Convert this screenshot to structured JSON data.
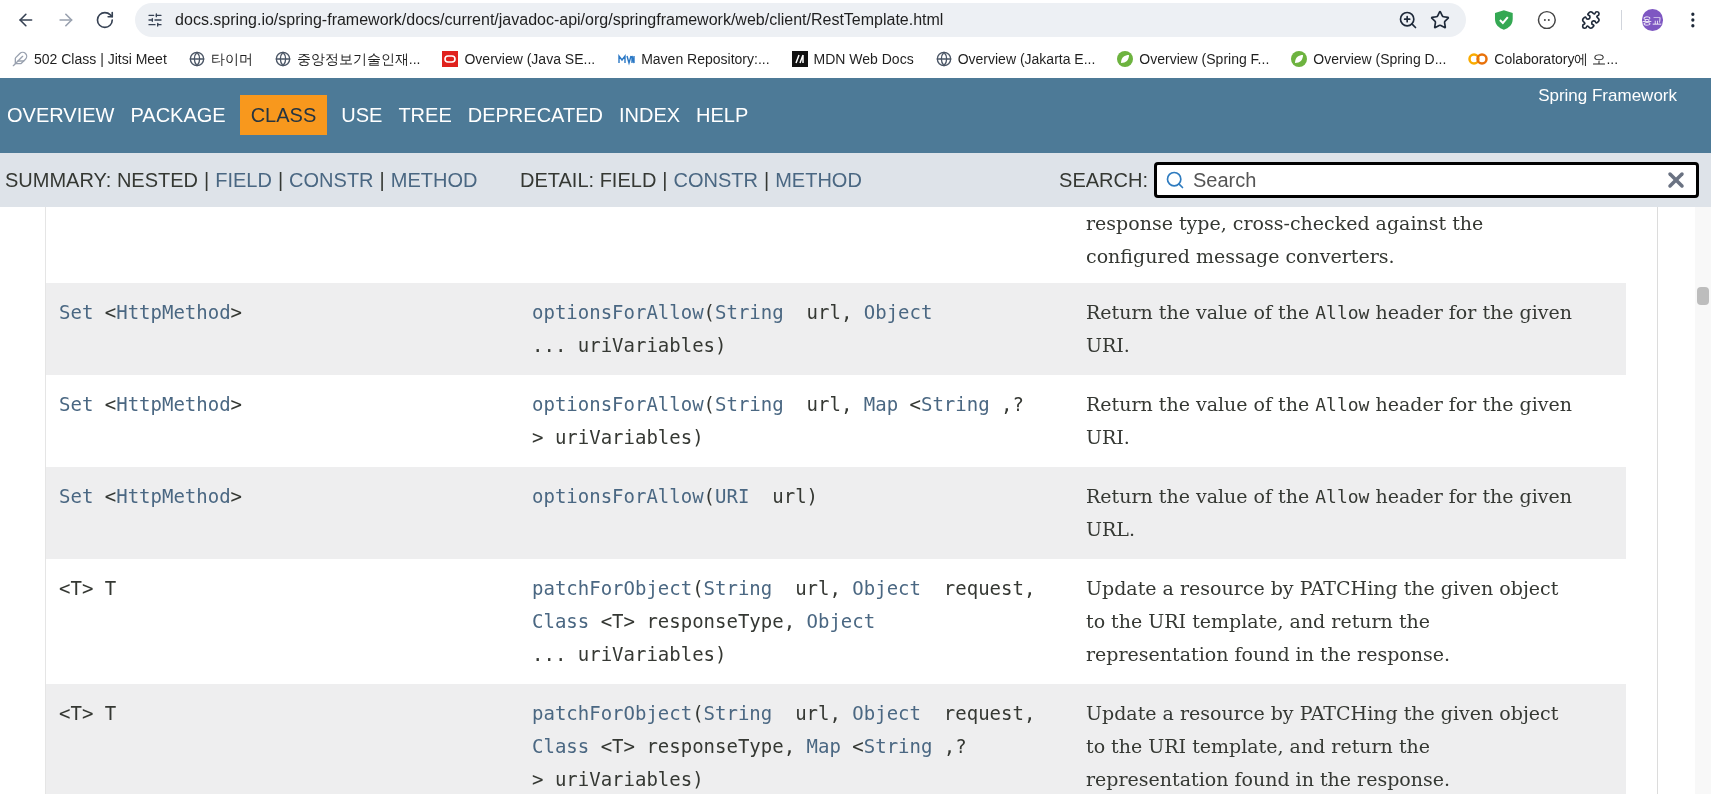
{
  "browser": {
    "url": "docs.spring.io/spring-framework/docs/current/javadoc-api/org/springframework/web/client/RestTemplate.html",
    "profile": "용교",
    "bookmarks": [
      {
        "kind": "feather",
        "label": "502 Class | Jitsi Meet"
      },
      {
        "kind": "globe",
        "label": "타이머"
      },
      {
        "kind": "globe",
        "label": "중앙정보기술인재..."
      },
      {
        "kind": "red-ring",
        "label": "Overview (Java SE..."
      },
      {
        "kind": "blue-tile",
        "label": "Maven Repository:..."
      },
      {
        "kind": "black-tile",
        "label": "MDN Web Docs"
      },
      {
        "kind": "globe",
        "label": "Overview (Jakarta E..."
      },
      {
        "kind": "green-leaf",
        "label": "Overview (Spring F..."
      },
      {
        "kind": "green-leaf",
        "label": "Overview (Spring D..."
      },
      {
        "kind": "orange-rings",
        "label": "Colaboratory에 오..."
      }
    ]
  },
  "nav": {
    "items": [
      {
        "label": "OVERVIEW",
        "selected": false
      },
      {
        "label": "PACKAGE",
        "selected": false
      },
      {
        "label": "CLASS",
        "selected": true
      },
      {
        "label": "USE",
        "selected": false
      },
      {
        "label": "TREE",
        "selected": false
      },
      {
        "label": "DEPRECATED",
        "selected": false
      },
      {
        "label": "INDEX",
        "selected": false
      },
      {
        "label": "HELP",
        "selected": false
      }
    ],
    "brand": "Spring Framework"
  },
  "subnav": {
    "summary": [
      {
        "kind": "text",
        "text": "SUMMARY: NESTED"
      },
      {
        "kind": "separator",
        "text": "|"
      },
      {
        "kind": "link",
        "text": "FIELD"
      },
      {
        "kind": "separator",
        "text": "|"
      },
      {
        "kind": "link",
        "text": "CONSTR"
      },
      {
        "kind": "separator",
        "text": "|"
      },
      {
        "kind": "link",
        "text": "METHOD"
      }
    ],
    "detail": [
      {
        "kind": "text",
        "text": "DETAIL: FIELD"
      },
      {
        "kind": "separator",
        "text": "|"
      },
      {
        "kind": "link",
        "text": "CONSTR"
      },
      {
        "kind": "separator",
        "text": "|"
      },
      {
        "kind": "link",
        "text": "METHOD"
      }
    ],
    "search_label": "SEARCH:",
    "search_placeholder": "Search"
  },
  "rows": [
    {
      "type": [],
      "method": [],
      "description": [
        [
          {
            "kind": "text",
            "text": "response type, cross-checked against the"
          }
        ],
        [
          {
            "kind": "text",
            "text": "configured message converters."
          }
        ]
      ]
    },
    {
      "type": [
        [
          {
            "kind": "link",
            "text": "Set"
          },
          {
            "kind": "plain",
            "text": " <"
          },
          {
            "kind": "link",
            "text": "HttpMethod"
          },
          {
            "kind": "plain",
            "text": ">"
          }
        ]
      ],
      "method": [
        [
          {
            "kind": "link",
            "text": "optionsForAllow"
          },
          {
            "kind": "plain",
            "text": "("
          },
          {
            "kind": "link",
            "text": "String"
          },
          {
            "kind": "plain",
            "text": "  url, "
          },
          {
            "kind": "link",
            "text": "Object"
          }
        ],
        [
          {
            "kind": "plain",
            "text": "... uriVariables)"
          }
        ]
      ],
      "description": [
        [
          {
            "kind": "text",
            "text": "Return the value of the "
          },
          {
            "kind": "code",
            "text": "Allow"
          },
          {
            "kind": "text",
            "text": " header for the given"
          }
        ],
        [
          {
            "kind": "text",
            "text": "URI."
          }
        ]
      ]
    },
    {
      "type": [
        [
          {
            "kind": "link",
            "text": "Set"
          },
          {
            "kind": "plain",
            "text": " <"
          },
          {
            "kind": "link",
            "text": "HttpMethod"
          },
          {
            "kind": "plain",
            "text": ">"
          }
        ]
      ],
      "method": [
        [
          {
            "kind": "link",
            "text": "optionsForAllow"
          },
          {
            "kind": "plain",
            "text": "("
          },
          {
            "kind": "link",
            "text": "String"
          },
          {
            "kind": "plain",
            "text": "  url, "
          },
          {
            "kind": "link",
            "text": "Map"
          },
          {
            "kind": "plain",
            "text": " <"
          },
          {
            "kind": "link",
            "text": "String"
          },
          {
            "kind": "plain",
            "text": " ,?"
          }
        ],
        [
          {
            "kind": "plain",
            "text": "> uriVariables)"
          }
        ]
      ],
      "description": [
        [
          {
            "kind": "text",
            "text": "Return the value of the "
          },
          {
            "kind": "code",
            "text": "Allow"
          },
          {
            "kind": "text",
            "text": " header for the given"
          }
        ],
        [
          {
            "kind": "text",
            "text": "URI."
          }
        ]
      ]
    },
    {
      "type": [
        [
          {
            "kind": "link",
            "text": "Set"
          },
          {
            "kind": "plain",
            "text": " <"
          },
          {
            "kind": "link",
            "text": "HttpMethod"
          },
          {
            "kind": "plain",
            "text": ">"
          }
        ]
      ],
      "method": [
        [
          {
            "kind": "link",
            "text": "optionsForAllow"
          },
          {
            "kind": "plain",
            "text": "("
          },
          {
            "kind": "link",
            "text": "URI"
          },
          {
            "kind": "plain",
            "text": "  url)"
          }
        ]
      ],
      "description": [
        [
          {
            "kind": "text",
            "text": "Return the value of the "
          },
          {
            "kind": "code",
            "text": "Allow"
          },
          {
            "kind": "text",
            "text": " header for the given"
          }
        ],
        [
          {
            "kind": "text",
            "text": "URL."
          }
        ]
      ]
    },
    {
      "type": [
        [
          {
            "kind": "plain",
            "text": "<T> T"
          }
        ]
      ],
      "method": [
        [
          {
            "kind": "link",
            "text": "patchForObject"
          },
          {
            "kind": "plain",
            "text": "("
          },
          {
            "kind": "link",
            "text": "String"
          },
          {
            "kind": "plain",
            "text": "  url, "
          },
          {
            "kind": "link",
            "text": "Object"
          },
          {
            "kind": "plain",
            "text": "  request,"
          }
        ],
        [
          {
            "kind": "link",
            "text": "Class"
          },
          {
            "kind": "plain",
            "text": " <T> responseType, "
          },
          {
            "kind": "link",
            "text": "Object"
          }
        ],
        [
          {
            "kind": "plain",
            "text": "... uriVariables)"
          }
        ]
      ],
      "description": [
        [
          {
            "kind": "text",
            "text": "Update a resource by PATCHing the given object"
          }
        ],
        [
          {
            "kind": "text",
            "text": "to the URI template, and return the"
          }
        ],
        [
          {
            "kind": "text",
            "text": "representation found in the response."
          }
        ]
      ]
    },
    {
      "type": [
        [
          {
            "kind": "plain",
            "text": "<T> T"
          }
        ]
      ],
      "method": [
        [
          {
            "kind": "link",
            "text": "patchForObject"
          },
          {
            "kind": "plain",
            "text": "("
          },
          {
            "kind": "link",
            "text": "String"
          },
          {
            "kind": "plain",
            "text": "  url, "
          },
          {
            "kind": "link",
            "text": "Object"
          },
          {
            "kind": "plain",
            "text": "  request,"
          }
        ],
        [
          {
            "kind": "link",
            "text": "Class"
          },
          {
            "kind": "plain",
            "text": " <T> responseType, "
          },
          {
            "kind": "link",
            "text": "Map"
          },
          {
            "kind": "plain",
            "text": " <"
          },
          {
            "kind": "link",
            "text": "String"
          },
          {
            "kind": "plain",
            "text": " ,?"
          }
        ],
        [
          {
            "kind": "plain",
            "text": "> uriVariables)"
          }
        ]
      ],
      "description": [
        [
          {
            "kind": "text",
            "text": "Update a resource by PATCHing the given object"
          }
        ],
        [
          {
            "kind": "text",
            "text": "to the URI template, and return the"
          }
        ],
        [
          {
            "kind": "text",
            "text": "representation found in the response."
          }
        ]
      ]
    }
  ]
}
